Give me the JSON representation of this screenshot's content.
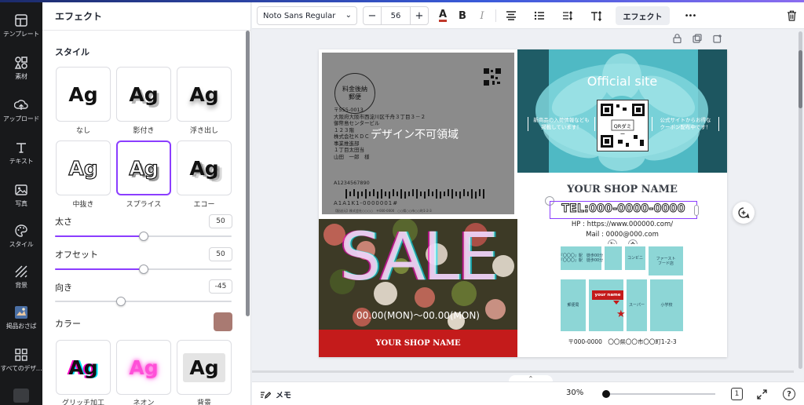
{
  "rail": {
    "items": [
      {
        "label": "テンプレート",
        "icon": "templates-icon"
      },
      {
        "label": "素材",
        "icon": "elements-icon"
      },
      {
        "label": "アップロード",
        "icon": "upload-icon"
      },
      {
        "label": "テキスト",
        "icon": "text-icon"
      },
      {
        "label": "写真",
        "icon": "photo-icon"
      },
      {
        "label": "スタイル",
        "icon": "palette-icon"
      },
      {
        "label": "背景",
        "icon": "background-icon"
      },
      {
        "label": "掲品おさば",
        "icon": "app-icon"
      },
      {
        "label": "すべてのデザ…",
        "icon": "all-designs-icon"
      }
    ]
  },
  "panel": {
    "title": "エフェクト",
    "style_heading": "スタイル",
    "styles": [
      {
        "label": "なし",
        "sample": "Ag"
      },
      {
        "label": "影付き",
        "sample": "Ag"
      },
      {
        "label": "浮き出し",
        "sample": "Ag"
      },
      {
        "label": "中抜き",
        "sample": "Ag"
      },
      {
        "label": "スプライス",
        "sample": "Ag"
      },
      {
        "label": "エコー",
        "sample": "Ag"
      },
      {
        "label": "グリッチ加工",
        "sample": "Ag"
      },
      {
        "label": "ネオン",
        "sample": "Ag"
      },
      {
        "label": "背景",
        "sample": "Ag"
      }
    ],
    "selected_style": "スプライス",
    "sliders": [
      {
        "label": "太さ",
        "value": "50",
        "fraction": 0.5
      },
      {
        "label": "オフセット",
        "value": "50",
        "fraction": 0.5
      },
      {
        "label": "向き",
        "value": "-45",
        "fraction": 0.375
      }
    ],
    "color_label": "カラー",
    "color_value": "#a97a72"
  },
  "toolbar": {
    "font": "Noto Sans Regular",
    "size_minus": "−",
    "size": "56",
    "size_plus": "+",
    "effect_label": "エフェクト",
    "more": "•••"
  },
  "design": {
    "stamp_line1": "料金後納",
    "stamp_line2": "郵便",
    "address": "〒555-0013\n大阪府大阪市西淀川区千舟３丁目３－２\n御幣島センタービル\n１２３階\n株式会社ＫＤＣ\n事業推進部\n１丁目太田当\n山田　一郎　様",
    "noprint_label": "デザイン不可領域",
    "postal_code": "A1234567890",
    "barcode_text": "A1A1K1-0000001#",
    "tiny_text": "【配送元】株式会社○○○○　〒000-0000　○○県○○市○○町1-2-3",
    "official_site": "Official site",
    "qr_label": "QRダミー",
    "left_caption_line1": "新商品の入荷情報なども",
    "left_caption_line2": "掲載しています！",
    "right_caption_line1": "公式サイトからお得な",
    "right_caption_line2": "クーポン配布中です！",
    "sale_word": "SALE",
    "sale_date": "00.00(MON)〜00.00(MON)",
    "shop_name_red": "YOUR SHOP NAME",
    "shop_name": "YOUR SHOP NAME",
    "tel": "TEL:000-0000-0000",
    "hp": "HP : https://www.000000.com/",
    "mail": "Mail : 0000@000.com",
    "map_labels": {
      "station1": "『〇〇〇』駅　徒歩00分\n『〇〇〇』駅　徒歩00分",
      "convenience": "コンビニ",
      "fastfood": "ファースト\nフード店",
      "post": "郵便局",
      "super": "スーパー",
      "school": "小学校",
      "your_name": "your name"
    },
    "address_footer": "〒000-0000　〇〇県〇〇市〇〇町1-2-3"
  },
  "bottom": {
    "memo_label": "メモ",
    "zoom": "30%",
    "page_count": "1",
    "help": "?"
  },
  "colors": {
    "accent": "#8b3dff",
    "rail_bg": "#18191b",
    "shop_band": "#c41b1b",
    "map_block": "#8dd6d6"
  }
}
